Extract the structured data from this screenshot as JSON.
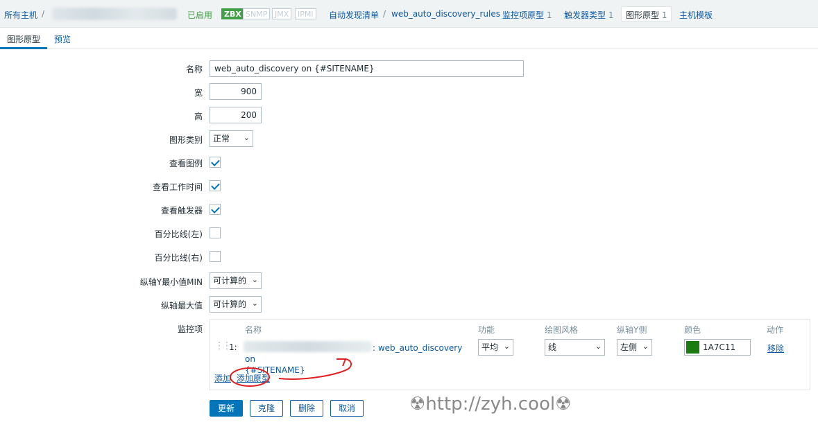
{
  "header": {
    "all_hosts": "所有主机",
    "sep": "/",
    "status": "已启用",
    "badges": [
      "ZBX",
      "SNMP",
      "JMX",
      "IPMI"
    ],
    "discovery_list": "自动发现清单",
    "rule_name": "web_auto_discovery_rules",
    "item_prototypes": "监控项原型",
    "item_prototypes_count": "1",
    "trigger_types": "触发器类型",
    "trigger_types_count": "1",
    "graph_prototypes": "图形原型",
    "graph_prototypes_count": "1",
    "host_templates": "主机模板"
  },
  "tabs": {
    "graph_prototype": "图形原型",
    "preview": "预览"
  },
  "form": {
    "name_label": "名称",
    "name_value": "web_auto_discovery on {#SITENAME}",
    "width_label": "宽",
    "width_value": "900",
    "height_label": "高",
    "height_value": "200",
    "graph_type_label": "图形类别",
    "graph_type_value": "正常",
    "show_legend_label": "查看图例",
    "show_work_period_label": "查看工作时间",
    "show_triggers_label": "查看触发器",
    "percentile_left_label": "百分比线(左)",
    "percentile_right_label": "百分比线(右)",
    "ymin_label": "纵轴Y最小值MIN",
    "ymin_value": "可计算的",
    "ymax_label": "纵轴最大值",
    "ymax_value": "可计算的",
    "items_label": "监控项"
  },
  "items_table": {
    "headers": {
      "name": "名称",
      "function": "功能",
      "draw_style": "绘图风格",
      "y_axis": "纵轴Y侧",
      "color": "颜色",
      "action": "动作"
    },
    "rows": [
      {
        "num": "1:",
        "name_suffix": ": web_auto_discovery on",
        "name_line2": "{#SITENAME}",
        "function": "平均",
        "draw_style": "线",
        "y_axis": "左侧",
        "color": "1A7C11",
        "remove": "移除"
      }
    ],
    "add": "添加",
    "add_prototype": "添加原型"
  },
  "buttons": {
    "update": "更新",
    "clone": "克隆",
    "delete": "删除",
    "cancel": "取消"
  },
  "watermark": "☢http://zyh.cool☢",
  "colors": {
    "accent": "#0275b8",
    "link": "#0c5aa6",
    "enabled": "#429e47",
    "swatch": "#1a7c11",
    "annotation": "#e02020"
  }
}
